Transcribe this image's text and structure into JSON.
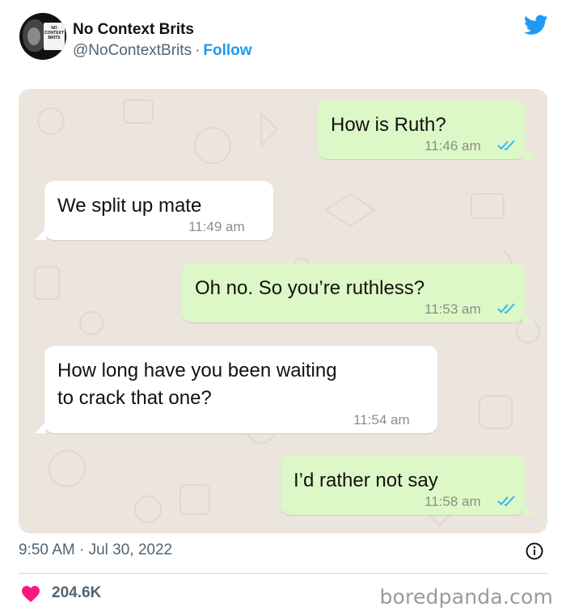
{
  "account": {
    "name": "No Context Brits",
    "handle": "@NoContextBrits",
    "separator": "·",
    "follow_label": "Follow",
    "avatar_text": "NO CONTEXT BRITS"
  },
  "chat": {
    "messages": [
      {
        "direction": "outgoing",
        "text": "How is Ruth?",
        "time": "11:46 am",
        "read": true
      },
      {
        "direction": "incoming",
        "text": "We split up mate",
        "time": "11:49 am"
      },
      {
        "direction": "outgoing",
        "text": "Oh no. So you’re ruthless?",
        "time": "11:53 am",
        "read": true
      },
      {
        "direction": "incoming",
        "text_line1": "How long have you been waiting",
        "text_line2": "to crack that one?",
        "time": "11:54 am"
      },
      {
        "direction": "outgoing",
        "text": "I’d rather not say",
        "time": "11:58 am",
        "read": true
      }
    ],
    "incoming_color": "#ffffff",
    "outgoing_color": "#dcf8c6",
    "read_tick_color": "#34b7f1"
  },
  "footer": {
    "timestamp": "9:50 AM · Jul 30, 2022",
    "likes": "204.6K",
    "watermark": "boredpanda.com"
  },
  "colors": {
    "accent": "#1d9bf0",
    "heart": "#f91880",
    "secondary_text": "#536471"
  },
  "icons": [
    "twitter-bird-icon",
    "double-check-icon",
    "info-icon",
    "heart-icon"
  ]
}
